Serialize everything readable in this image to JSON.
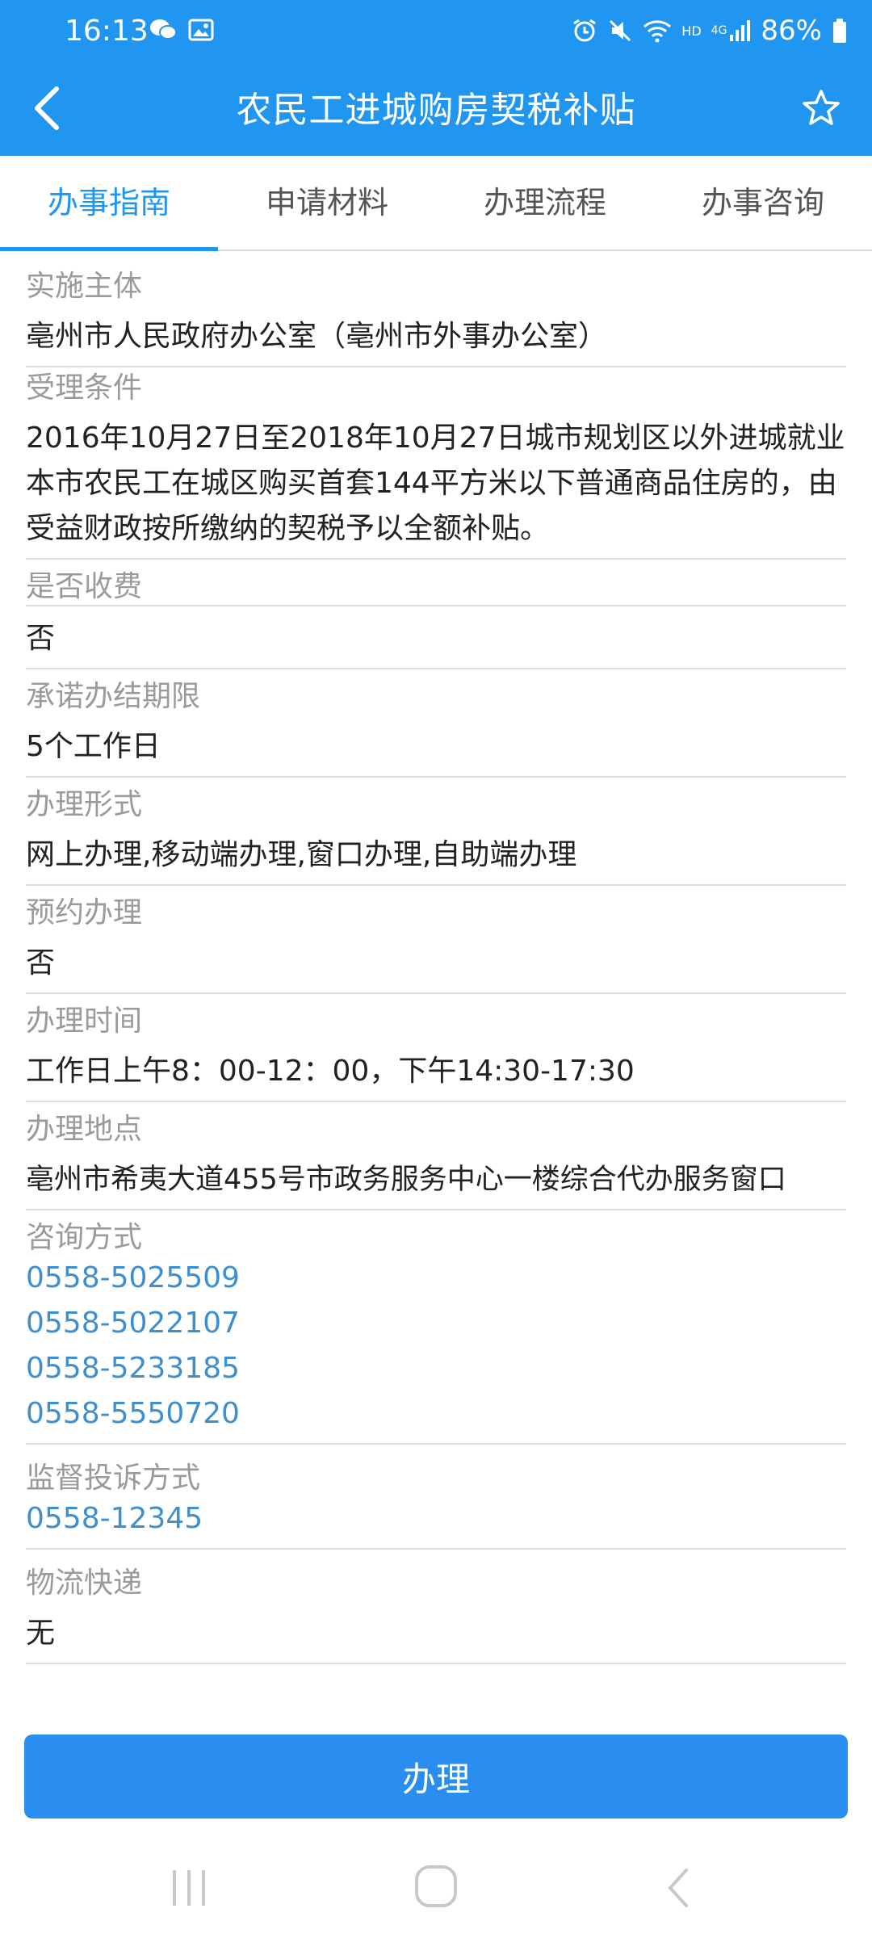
{
  "status_bar": {
    "time": "16:13",
    "battery": "86%",
    "network": "4G",
    "hd": "HD"
  },
  "app_bar": {
    "title": "农民工进城购房契税补贴"
  },
  "tabs": [
    {
      "label": "办事指南",
      "active": true
    },
    {
      "label": "申请材料",
      "active": false
    },
    {
      "label": "办理流程",
      "active": false
    },
    {
      "label": "办事咨询",
      "active": false
    }
  ],
  "guide": {
    "implementer": {
      "label": "实施主体",
      "value": "亳州市人民政府办公室（亳州市外事办公室）"
    },
    "conditions": {
      "label": "受理条件",
      "value": "2016年10月27日至2018年10月27日城市规划区以外进城就业本市农民工在城区购买首套144平方米以下普通商品住房的，由受益财政按所缴纳的契税予以全额补贴。"
    },
    "fee": {
      "label": "是否收费",
      "value": "否"
    },
    "deadline": {
      "label": "承诺办结期限",
      "value": "5个工作日"
    },
    "form": {
      "label": "办理形式",
      "value": "网上办理,移动端办理,窗口办理,自助端办理"
    },
    "appointment": {
      "label": "预约办理",
      "value": "否"
    },
    "hours": {
      "label": "办理时间",
      "value": "工作日上午8：00-12：00，下午14:30-17:30"
    },
    "location": {
      "label": "办理地点",
      "value": "亳州市希夷大道455号市政务服务中心一楼综合代办服务窗口"
    },
    "consult": {
      "label": "咨询方式",
      "phones": [
        "0558-5025509",
        "0558-5022107",
        "0558-5233185",
        "0558-5550720"
      ]
    },
    "complaint": {
      "label": "监督投诉方式",
      "phone": "0558-12345"
    },
    "logistics": {
      "label": "物流快递",
      "value": "无"
    }
  },
  "action_button": {
    "label": "办理"
  },
  "colors": {
    "primary": "#2196f0",
    "link": "#3d8fd0",
    "label": "#9a9a9a"
  }
}
